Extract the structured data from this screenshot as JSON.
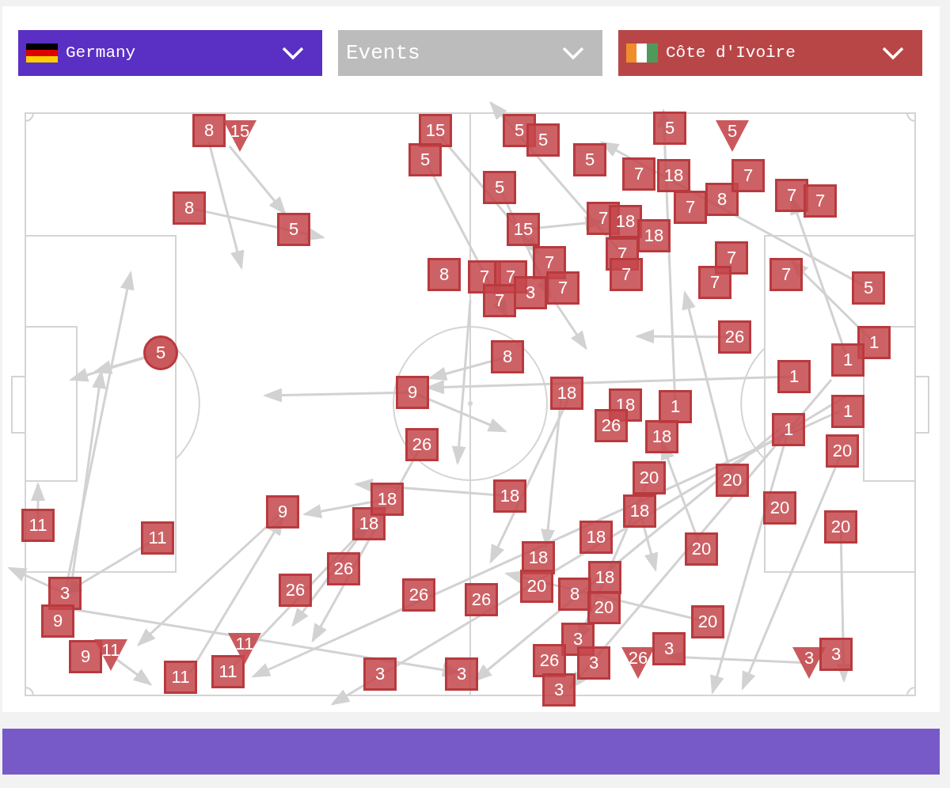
{
  "dropdowns": [
    {
      "kind": "team",
      "label": "Germany",
      "color": "#5a2fc4"
    },
    {
      "kind": "filter",
      "label": "Events",
      "color": "#bcbcbc"
    },
    {
      "kind": "team",
      "label": "Côte d'Ivoire",
      "color": "#b94647"
    }
  ],
  "markers": [
    {
      "kind": "square",
      "label": "8"
    },
    {
      "kind": "triangle",
      "label": "15"
    },
    {
      "kind": "square",
      "label": "8"
    },
    {
      "kind": "square",
      "label": "5"
    },
    {
      "kind": "circle",
      "label": "5"
    },
    {
      "kind": "square",
      "label": "11"
    },
    {
      "kind": "square",
      "label": "11"
    },
    {
      "kind": "square",
      "label": "3"
    },
    {
      "kind": "square",
      "label": "9"
    },
    {
      "kind": "square",
      "label": "9"
    },
    {
      "kind": "triangle",
      "label": "11"
    },
    {
      "kind": "square",
      "label": "11"
    },
    {
      "kind": "square",
      "label": "11"
    },
    {
      "kind": "triangle",
      "label": "11"
    },
    {
      "kind": "square",
      "label": "9"
    },
    {
      "kind": "square",
      "label": "26"
    },
    {
      "kind": "square",
      "label": "26"
    },
    {
      "kind": "square",
      "label": "18"
    },
    {
      "kind": "square",
      "label": "18"
    },
    {
      "kind": "square",
      "label": "26"
    },
    {
      "kind": "square",
      "label": "9"
    },
    {
      "kind": "square",
      "label": "15"
    },
    {
      "kind": "square",
      "label": "5"
    },
    {
      "kind": "square",
      "label": "8"
    },
    {
      "kind": "square",
      "label": "3"
    },
    {
      "kind": "square",
      "label": "26"
    },
    {
      "kind": "square",
      "label": "3"
    },
    {
      "kind": "square",
      "label": "5"
    },
    {
      "kind": "square",
      "label": "5"
    },
    {
      "kind": "square",
      "label": "5"
    },
    {
      "kind": "square",
      "label": "15"
    },
    {
      "kind": "square",
      "label": "7"
    },
    {
      "kind": "square",
      "label": "7"
    },
    {
      "kind": "square",
      "label": "7"
    },
    {
      "kind": "square",
      "label": "3"
    },
    {
      "kind": "square",
      "label": "7"
    },
    {
      "kind": "square",
      "label": "7"
    },
    {
      "kind": "square",
      "label": "8"
    },
    {
      "kind": "square",
      "label": "18"
    },
    {
      "kind": "square",
      "label": "18"
    },
    {
      "kind": "square",
      "label": "20"
    },
    {
      "kind": "square",
      "label": "26"
    },
    {
      "kind": "square",
      "label": "8"
    },
    {
      "kind": "square",
      "label": "5"
    },
    {
      "kind": "square",
      "label": "7"
    },
    {
      "kind": "square",
      "label": "18"
    },
    {
      "kind": "square",
      "label": "18"
    },
    {
      "kind": "square",
      "label": "7"
    },
    {
      "kind": "square",
      "label": "7"
    },
    {
      "kind": "square",
      "label": "18"
    },
    {
      "kind": "square",
      "label": "18"
    },
    {
      "kind": "square",
      "label": "26"
    },
    {
      "kind": "square",
      "label": "1"
    },
    {
      "kind": "square",
      "label": "18"
    },
    {
      "kind": "square",
      "label": "20"
    },
    {
      "kind": "square",
      "label": "18"
    },
    {
      "kind": "square",
      "label": "18"
    },
    {
      "kind": "square",
      "label": "18"
    },
    {
      "kind": "square",
      "label": "20"
    },
    {
      "kind": "square",
      "label": "3"
    },
    {
      "kind": "square",
      "label": "26"
    },
    {
      "kind": "square",
      "label": "3"
    },
    {
      "kind": "square",
      "label": "3"
    },
    {
      "kind": "triangle",
      "label": "26"
    },
    {
      "kind": "square",
      "label": "3"
    },
    {
      "kind": "square",
      "label": "20"
    },
    {
      "kind": "square",
      "label": "20"
    },
    {
      "kind": "square",
      "label": "20"
    },
    {
      "kind": "square",
      "label": "20"
    },
    {
      "kind": "square",
      "label": "7"
    },
    {
      "kind": "square",
      "label": "18"
    },
    {
      "kind": "square",
      "label": "7"
    },
    {
      "kind": "square",
      "label": "5"
    },
    {
      "kind": "triangle",
      "label": "5"
    },
    {
      "kind": "square",
      "label": "8"
    },
    {
      "kind": "square",
      "label": "7"
    },
    {
      "kind": "square",
      "label": "7"
    },
    {
      "kind": "square",
      "label": "7"
    },
    {
      "kind": "square",
      "label": "7"
    },
    {
      "kind": "square",
      "label": "7"
    },
    {
      "kind": "square",
      "label": "7"
    },
    {
      "kind": "square",
      "label": "26"
    },
    {
      "kind": "square",
      "label": "5"
    },
    {
      "kind": "square",
      "label": "1"
    },
    {
      "kind": "square",
      "label": "1"
    },
    {
      "kind": "square",
      "label": "1"
    },
    {
      "kind": "square",
      "label": "1"
    },
    {
      "kind": "square",
      "label": "1"
    },
    {
      "kind": "square",
      "label": "20"
    },
    {
      "kind": "square",
      "label": "20"
    },
    {
      "kind": "triangle",
      "label": "3"
    },
    {
      "kind": "square",
      "label": "3"
    }
  ]
}
